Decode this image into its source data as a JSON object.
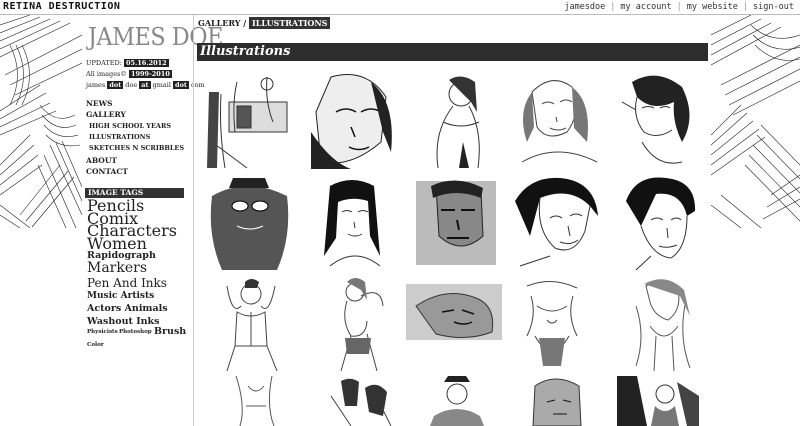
{
  "topbar": {
    "brand": "RETINA DESTRUCTION",
    "links": [
      "jamesdoe",
      "my account",
      "my website",
      "sign-out"
    ]
  },
  "sidebar": {
    "logo": "JAMES DOE",
    "updated_label": "UPDATED:",
    "updated_date": "05.16.2012",
    "all_images_label": "All images©",
    "all_images_years": "1999-2010",
    "email_parts": [
      "james",
      "dot",
      "doe",
      "at",
      "gmail",
      "dot",
      "com"
    ],
    "nav": {
      "news": "NEWS",
      "gallery": "GALLERY",
      "high_school": "HIGH SCHOOL YEARS",
      "illustrations": "ILLUSTRATIONS",
      "sketches": "SKETCHES N SCRIBBLES",
      "about": "ABOUT",
      "contact": "CONTACT"
    },
    "image_tags_title": "IMAGE TAGS",
    "tags": [
      "Pencils",
      "Comix",
      "Characters",
      "Women",
      "Rapidograph",
      "Markers",
      "Pen And Inks",
      "Music Artists",
      "Actors Animals",
      "Washout Inks",
      "Physicists",
      "Photoshop",
      "Brush",
      "Color"
    ]
  },
  "breadcrumb": {
    "gallery": "GALLERY",
    "sep": "/",
    "current": "ILLUSTRATIONS"
  },
  "section_title": "Illustrations"
}
